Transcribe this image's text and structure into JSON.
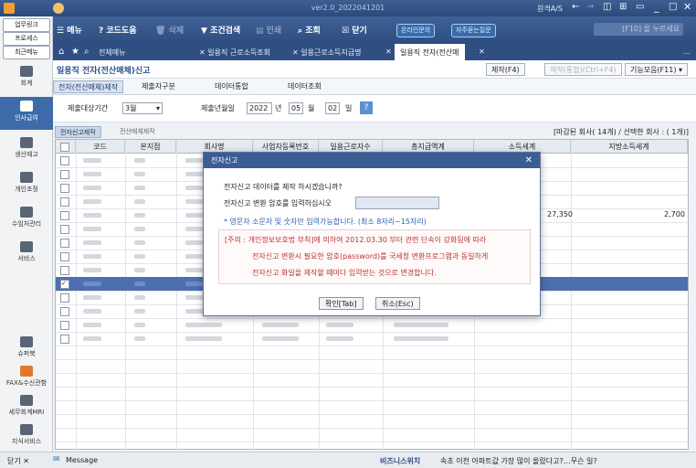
{
  "titlebar": {
    "version": "ver2.0_2022041201",
    "remote_label": "원격A/S"
  },
  "toolbar": {
    "menu": "메뉴",
    "codehelp": "코드도움",
    "delete": "삭제",
    "condition_search": "조건검색",
    "print": "인쇄",
    "query": "조회",
    "close": "닫기",
    "online_inquiry": "온라인문의",
    "faq": "자주묻는질문",
    "search_placeholder": "[F10] 을 누르세요"
  },
  "sidebar": {
    "top_buttons": [
      "업무링크",
      "프로세스",
      "최근메뉴"
    ],
    "items": [
      {
        "label": "회계",
        "active": false
      },
      {
        "label": "인사급여",
        "active": true
      },
      {
        "label": "생산재고",
        "active": false
      },
      {
        "label": "개인조정",
        "active": false
      },
      {
        "label": "수임처관리",
        "active": false
      },
      {
        "label": "서비스",
        "active": false
      },
      {
        "label": "슈퍼북",
        "active": false
      },
      {
        "label": "FAX&수신관함",
        "active": false
      },
      {
        "label": "세무회계MRI",
        "active": false
      },
      {
        "label": "지식서비스",
        "active": false
      }
    ],
    "collapse_label": "닫기"
  },
  "tabs": [
    "전체메뉴",
    "일용직 근로소득조회",
    "일용근로소득지급명",
    "일용직 전자(전산매"
  ],
  "page": {
    "title": "일용직 전자(전산매체)신고",
    "buttons": {
      "make": "제작(F4)",
      "make_combined": "제작(통합)(Ctrl+F4)",
      "functions": "기능모음(F11)"
    }
  },
  "subtabs": [
    "전자(전산매체)제작",
    "제출자구분",
    "데이터통합",
    "데이터조회"
  ],
  "filter": {
    "period_label": "제출대상기간",
    "period_value": "3월",
    "date_label": "제출년월일",
    "year": "2022",
    "year_unit": "년",
    "month": "05",
    "month_unit": "월",
    "day": "02",
    "day_unit": "일"
  },
  "grid_tabs": [
    "전자신고제작",
    "전산매체제작"
  ],
  "grid_info": "[마감된 회사( 14개) / 선택한 회사 : ( 1개)]",
  "grid_headers": [
    "코드",
    "본지점",
    "회사명",
    "사업자등록번호",
    "일용근로자수",
    "총지급액계",
    "소득세계",
    "지방소득세계"
  ],
  "grid_values": {
    "income_tax": "27,350",
    "local_tax": "2,700"
  },
  "dialog": {
    "title": "전자신고",
    "question": "전자신고 데이터를 제작 하시겠습니까?",
    "password_label": "전자신고 변환 암호를 입력하십시오",
    "hint": "* 영문자 소문자 및 숫자만 입력가능합니다. (최소 8자리~15자리)",
    "notice_lines": [
      "[주의 : 개인정보보호법 부칙]에 의하여 2012.03.30 부터 관련 단속이 강화됨에 따라",
      "전자신고 변환시 필요한 암호(password)를 국세청 변환프로그램과 동일하게",
      "전자신고 화일을 제작할 때마다 입력받는 것으로 변경합니다."
    ],
    "ok": "확인[Tab]",
    "cancel": "취소(Esc)"
  },
  "statusbar": {
    "message": "Message",
    "business_label": "비즈니스위치",
    "news": "속초 이천 아파트값 가장 많이 올랐다고?…무슨 일?"
  },
  "colors": {
    "accent": "#2f4f82",
    "selected_row": "#4d6fb0",
    "notice": "#b33333"
  }
}
